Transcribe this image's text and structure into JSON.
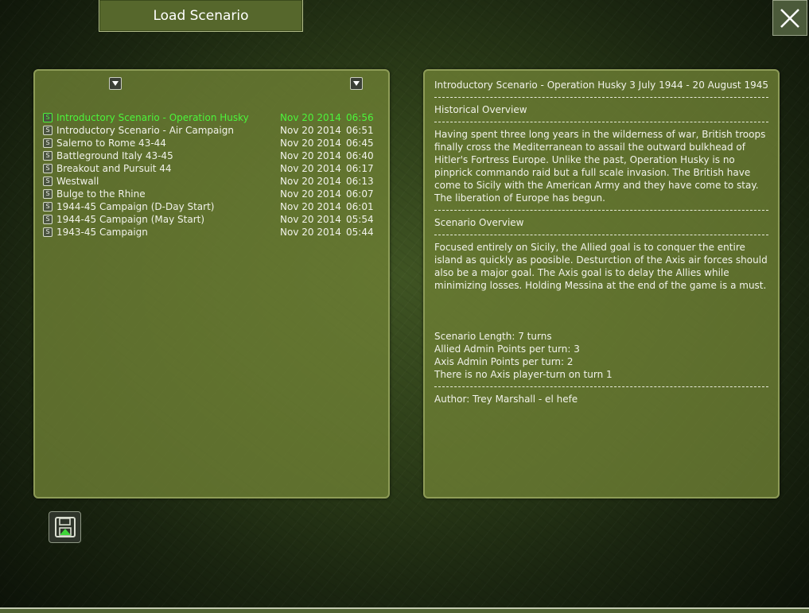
{
  "window": {
    "title": "Load Scenario"
  },
  "colors": {
    "accent_selected": "#4cf43b",
    "panel": "#6e8034",
    "text": "#f1f2ea"
  },
  "icons": {
    "close": "close-icon",
    "sort": "sort-down-icon",
    "scenario": "scenario-file-icon",
    "save": "floppy-disk-icon"
  },
  "scenarios": [
    {
      "name": "Introductory Scenario - Operation Husky",
      "date": "Nov 20 2014",
      "time": "06:56",
      "selected": true
    },
    {
      "name": "Introductory Scenario - Air Campaign",
      "date": "Nov 20 2014",
      "time": "06:51",
      "selected": false
    },
    {
      "name": "Salerno to Rome 43-44",
      "date": "Nov 20 2014",
      "time": "06:45",
      "selected": false
    },
    {
      "name": "Battleground Italy 43-45",
      "date": "Nov 20 2014",
      "time": "06:40",
      "selected": false
    },
    {
      "name": "Breakout and Pursuit 44",
      "date": "Nov 20 2014",
      "time": "06:17",
      "selected": false
    },
    {
      "name": "Westwall",
      "date": "Nov 20 2014",
      "time": "06:13",
      "selected": false
    },
    {
      "name": "Bulge to the Rhine",
      "date": "Nov 20 2014",
      "time": "06:07",
      "selected": false
    },
    {
      "name": "1944-45 Campaign (D-Day Start)",
      "date": "Nov 20 2014",
      "time": "06:01",
      "selected": false
    },
    {
      "name": "1944-45 Campaign (May Start)",
      "date": "Nov 20 2014",
      "time": "05:54",
      "selected": false
    },
    {
      "name": "1943-45 Campaign",
      "date": "Nov 20 2014",
      "time": "05:44",
      "selected": false
    }
  ],
  "detail": {
    "title": "Introductory Scenario - Operation Husky",
    "dates": "3 July 1944 - 20 August 1945",
    "historical_heading": "Historical Overview",
    "historical_text": "Having spent three long years in the wilderness of war, British troops finally cross the Mediterranean to assail the outward bulkhead of Hitler's Fortress Europe.  Unlike the past, Operation Husky is no pinprick commando raid but a full scale invasion.  The British have come to Sicily with the American Army and they have come to stay.  The liberation of Europe has begun.",
    "scenario_heading": "Scenario Overview",
    "scenario_text": "Focused entirely on Sicily, the Allied goal is to conquer the entire island as quickly as poosible. Desturction of the Axis air forces should also be a major goal. The Axis goal is to delay the Allies while minimizing losses. Holding Messina at the end of the game is a must.",
    "length": "Scenario Length: 7 turns",
    "allied_admin": "Allied Admin Points per turn: 3",
    "axis_admin": "Axis Admin Points per turn: 2",
    "axis_note": "There is no Axis player-turn on turn 1",
    "author": "Author: Trey Marshall - el hefe"
  }
}
